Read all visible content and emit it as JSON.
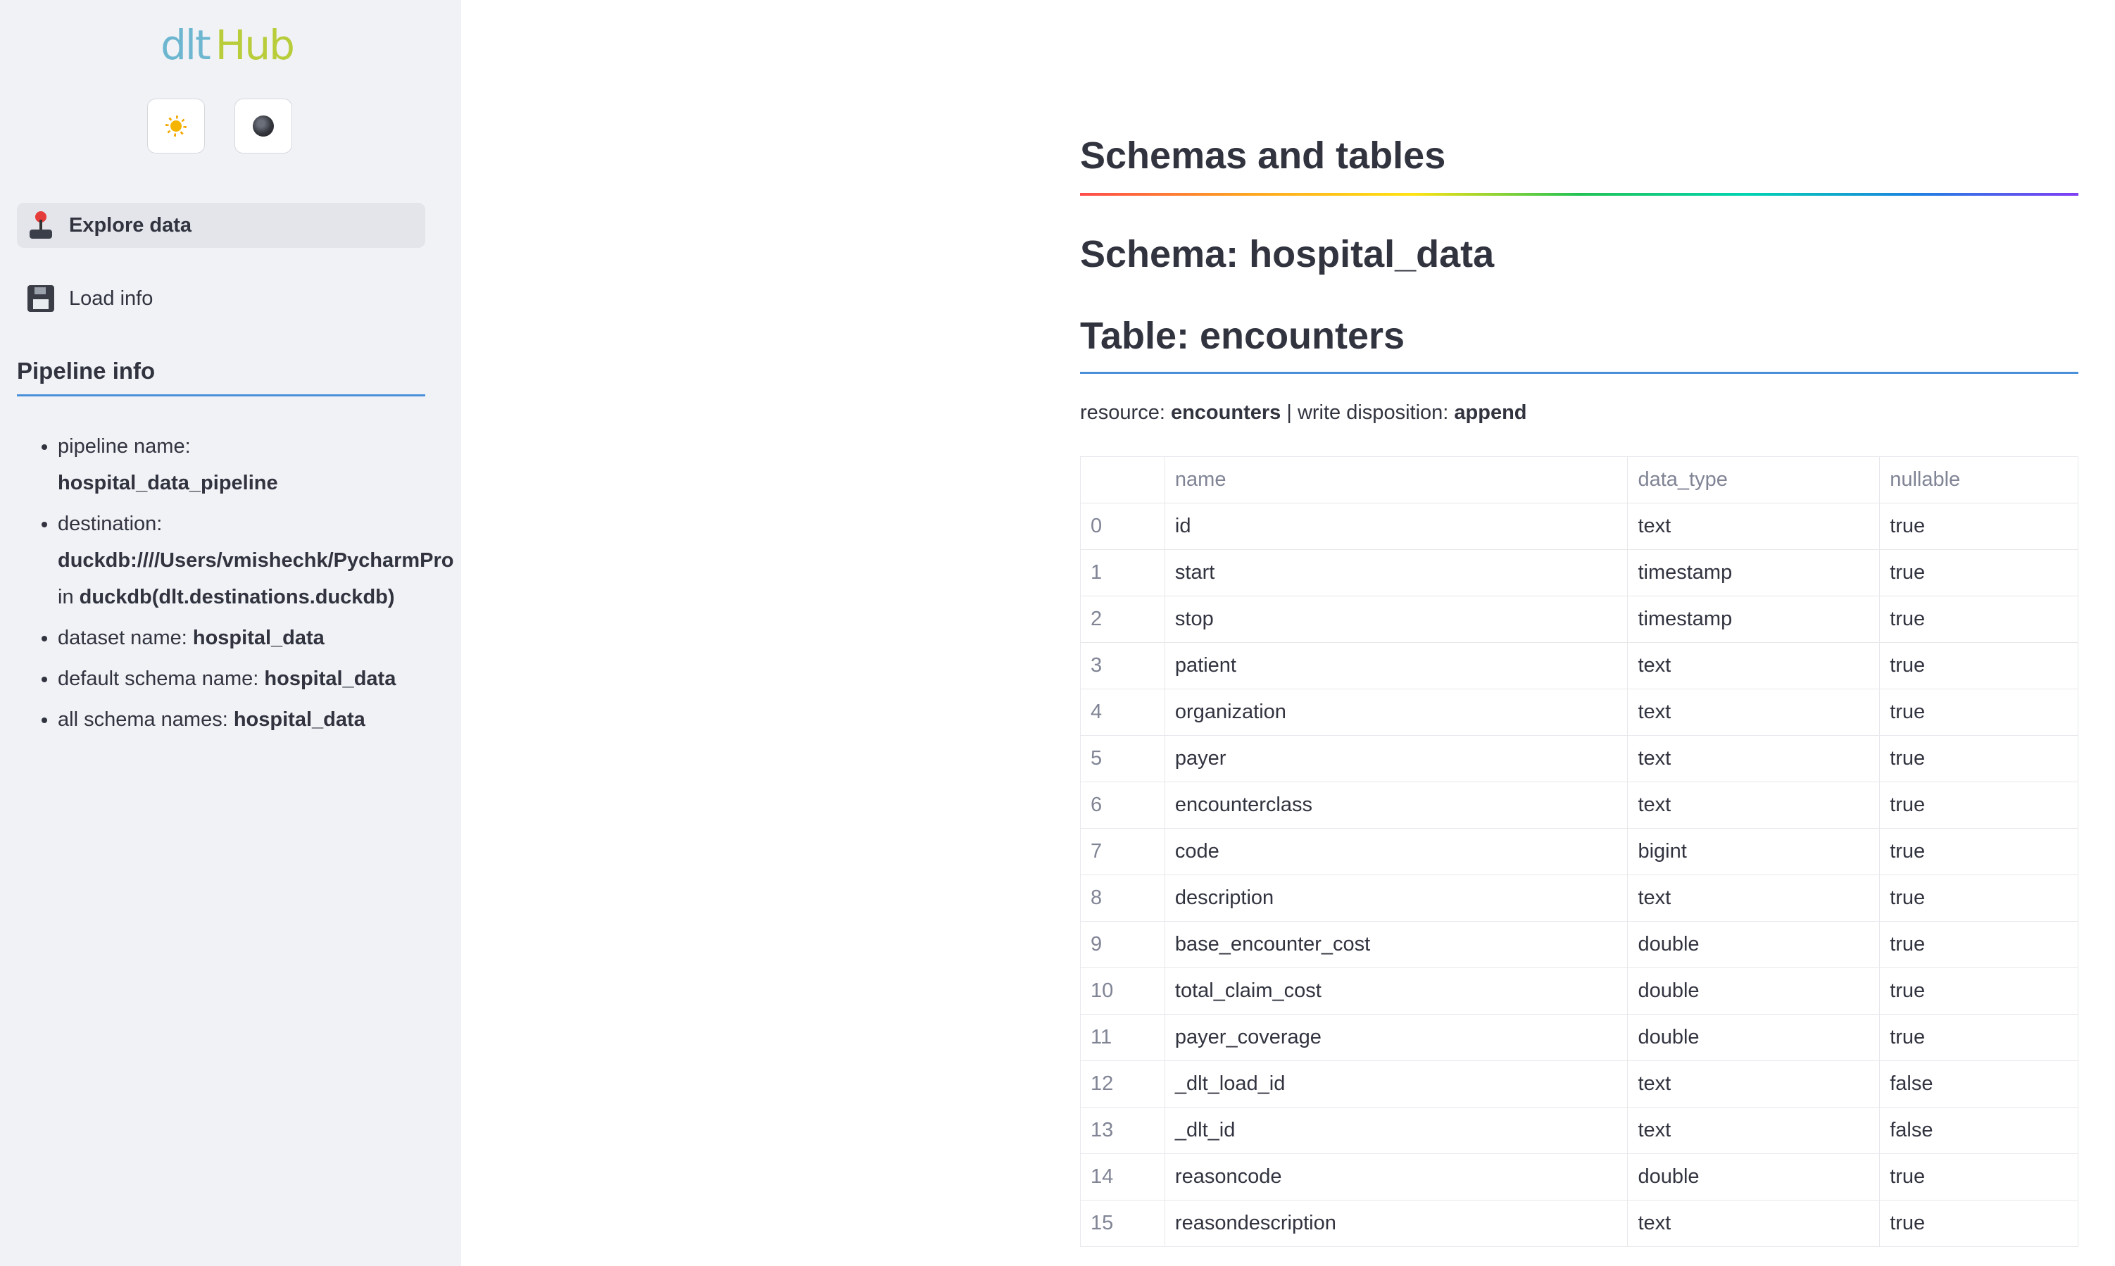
{
  "sidebar": {
    "logo": {
      "part1": "dlt",
      "part2": "Hub"
    },
    "theme_buttons": [
      {
        "icon": "sun-icon"
      },
      {
        "icon": "moon-icon"
      }
    ],
    "nav": [
      {
        "label": "Explore data",
        "icon": "joystick-icon",
        "active": true
      },
      {
        "label": "Load info",
        "icon": "floppy-disk-icon",
        "active": false
      }
    ],
    "pipeline_info": {
      "heading": "Pipeline info",
      "pipeline_name_label": "pipeline name:",
      "pipeline_name": "hospital_data_pipeline",
      "destination_label": "destination:",
      "destination": "duckdb:////Users/vmishechk/PycharmPro",
      "destination_in": "in",
      "destination_type": "duckdb(dlt.destinations.duckdb)",
      "dataset_name_label": "dataset name:",
      "dataset_name": "hospital_data",
      "default_schema_label": "default schema name:",
      "default_schema": "hospital_data",
      "all_schemas_label": "all schema names:",
      "all_schemas": "hospital_data"
    }
  },
  "main": {
    "title": "Schemas and tables",
    "schema_title": "Schema: hospital_data",
    "table_title": "Table: encounters",
    "resource_label": "resource:",
    "resource": "encounters",
    "separator": "|",
    "disposition_label": "write disposition:",
    "disposition": "append",
    "table": {
      "columns": [
        "",
        "name",
        "data_type",
        "nullable"
      ],
      "rows": [
        [
          "0",
          "id",
          "text",
          "true"
        ],
        [
          "1",
          "start",
          "timestamp",
          "true"
        ],
        [
          "2",
          "stop",
          "timestamp",
          "true"
        ],
        [
          "3",
          "patient",
          "text",
          "true"
        ],
        [
          "4",
          "organization",
          "text",
          "true"
        ],
        [
          "5",
          "payer",
          "text",
          "true"
        ],
        [
          "6",
          "encounterclass",
          "text",
          "true"
        ],
        [
          "7",
          "code",
          "bigint",
          "true"
        ],
        [
          "8",
          "description",
          "text",
          "true"
        ],
        [
          "9",
          "base_encounter_cost",
          "double",
          "true"
        ],
        [
          "10",
          "total_claim_cost",
          "double",
          "true"
        ],
        [
          "11",
          "payer_coverage",
          "double",
          "true"
        ],
        [
          "12",
          "_dlt_load_id",
          "text",
          "false"
        ],
        [
          "13",
          "_dlt_id",
          "text",
          "false"
        ],
        [
          "14",
          "reasoncode",
          "double",
          "true"
        ],
        [
          "15",
          "reasondescription",
          "text",
          "true"
        ]
      ]
    }
  }
}
